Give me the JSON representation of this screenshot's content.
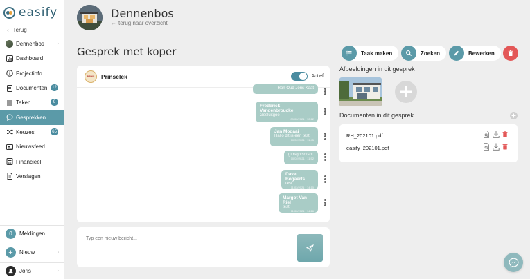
{
  "brand": {
    "name": "easify"
  },
  "sidebar": {
    "back_label": "Terug",
    "items": [
      {
        "label": "Dennenbos",
        "icon": "project-avatar-icon",
        "badge": "",
        "arrow": "›"
      },
      {
        "label": "Dashboard",
        "icon": "dashboard-icon",
        "badge": "",
        "arrow": ""
      },
      {
        "label": "Projectinfo",
        "icon": "info-icon",
        "badge": "",
        "arrow": ""
      },
      {
        "label": "Documenten",
        "icon": "document-icon",
        "badge": "12",
        "arrow": ""
      },
      {
        "label": "Taken",
        "icon": "task-icon",
        "badge": "9",
        "arrow": ""
      },
      {
        "label": "Gesprekken",
        "icon": "chat-icon",
        "badge": "",
        "arrow": ""
      },
      {
        "label": "Keuzes",
        "icon": "shuffle-icon",
        "badge": "65",
        "arrow": ""
      },
      {
        "label": "Nieuwsfeed",
        "icon": "newsfeed-icon",
        "badge": "",
        "arrow": ""
      },
      {
        "label": "Financieel",
        "icon": "finance-icon",
        "badge": "",
        "arrow": ""
      },
      {
        "label": "Verslagen",
        "icon": "report-icon",
        "badge": "",
        "arrow": ""
      }
    ],
    "notifications": {
      "count": "0",
      "label": "Meldingen"
    },
    "new": {
      "label": "Nieuw"
    },
    "user": {
      "label": "Joris"
    }
  },
  "header": {
    "project_title": "Dennenbos",
    "back_to_overview": "terug naar overzicht"
  },
  "page": {
    "title": "Gesprek met koper"
  },
  "chat": {
    "contact_name": "Prinselek",
    "contact_logo_text": "PRINS",
    "toggle_label": "Actief",
    "messages": [
      {
        "name": "",
        "text": "Ron Oud Joris Kaat",
        "date": "09/02/2021 · 10:14"
      },
      {
        "name": "Frederick Vandenbroucke",
        "text": "Gesluitgoe",
        "date": "09/02/2021 · 10:22"
      },
      {
        "name": "Jan Modaai",
        "text": "Hallo dit is een test!",
        "date": "10/02/2021 · 11:45"
      },
      {
        "name": "",
        "text": "gfdsgdfsdfsdf",
        "date": "10/02/2021 · 11:52"
      },
      {
        "name": "Dave Bogaerts",
        "text": "test",
        "date": "11/02/2021 · 14:10"
      },
      {
        "name": "Margot Van Riel",
        "text": "test",
        "date": "11/02/2021 · 14:26"
      }
    ],
    "composer_placeholder": "Typ een nieuw bericht..."
  },
  "toolbar": {
    "task_label": "Taak maken",
    "search_label": "Zoeken",
    "edit_label": "Bewerken"
  },
  "images_section": {
    "title": "Afbeeldingen in dit gesprek"
  },
  "documents_section": {
    "title": "Documenten in dit gesprek",
    "files": [
      "RH_202101.pdf",
      "easify_202101.pdf"
    ]
  },
  "colors": {
    "accent": "#5b9aa8",
    "bubble": "#a9ccc6",
    "danger": "#e35757",
    "brand": "#2f5f72"
  }
}
